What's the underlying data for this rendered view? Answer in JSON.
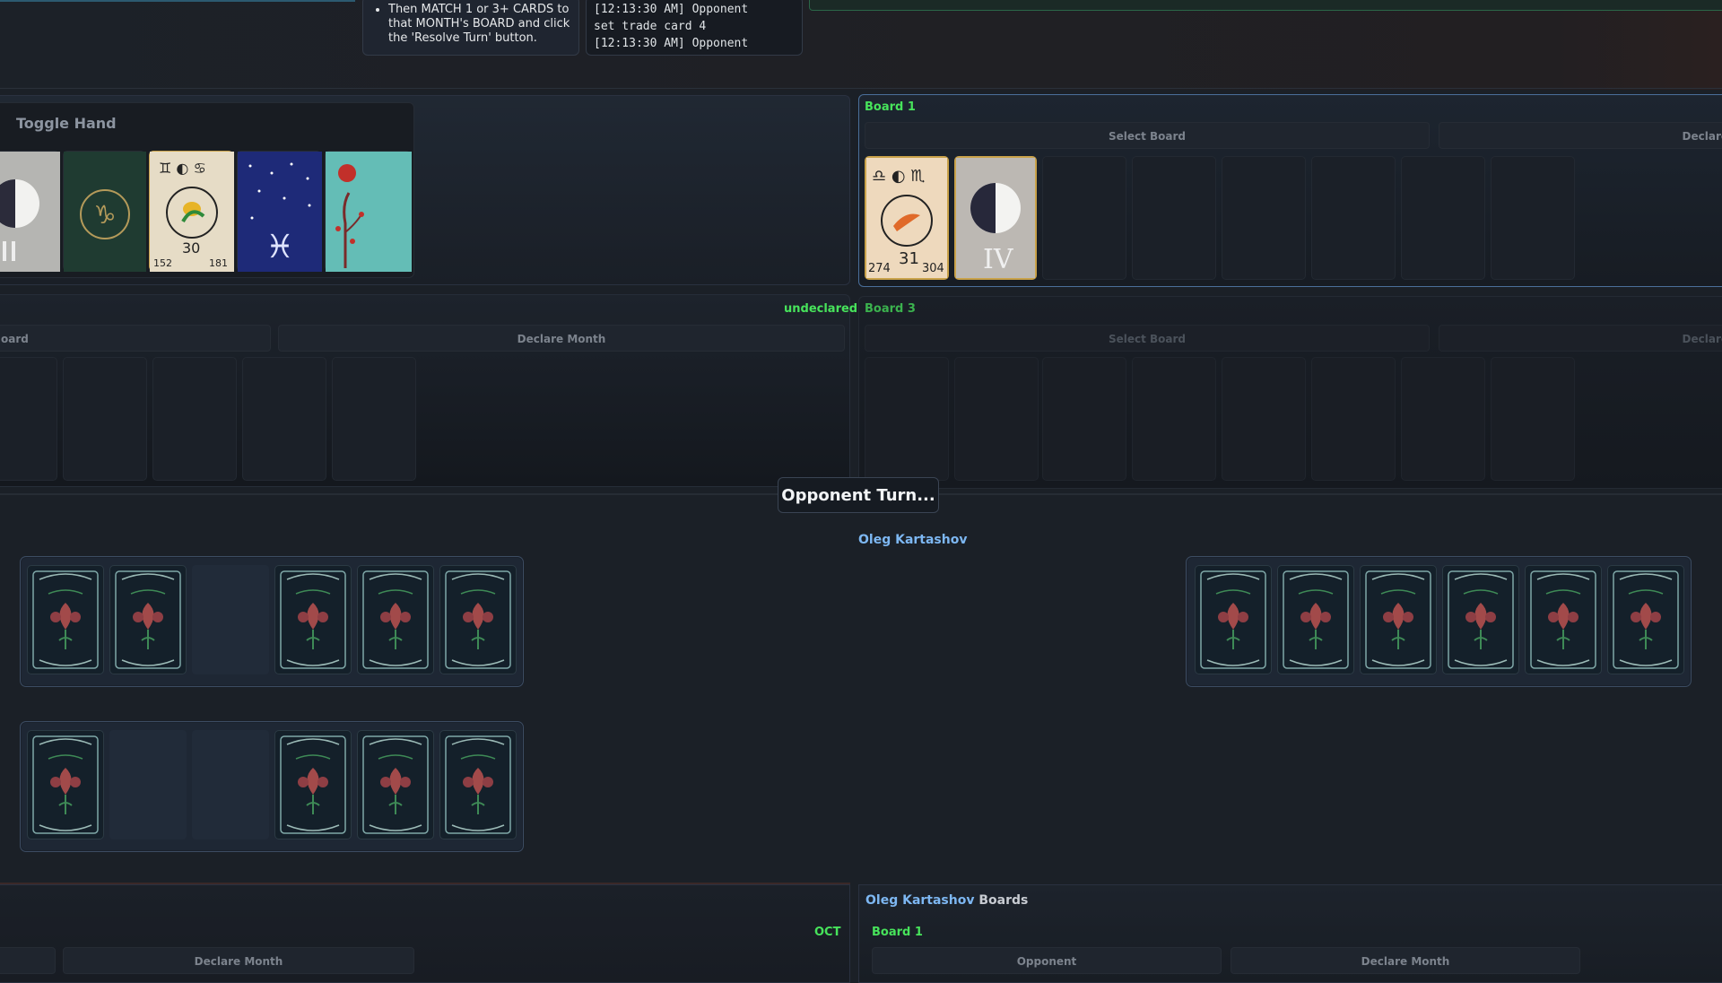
{
  "instructions": {
    "item": "Then MATCH 1 or 3+ CARDS to that MONTH's BOARD and click the 'Resolve Turn' button."
  },
  "log": {
    "lines": [
      "[12:13:30 AM] Opponent",
      "set trade card 4",
      "[12:13:30 AM] Opponent"
    ]
  },
  "hand": {
    "toggle_label": "Toggle Hand",
    "card_numbers": [
      "30",
      "152",
      "181"
    ]
  },
  "left_mid": {
    "status": "undeclared",
    "select_label": "oard",
    "declare_label": "Declare Month"
  },
  "board1": {
    "title": "Board 1",
    "select_label": "Select Board",
    "declare_label": "Declare",
    "card_numbers": [
      "31",
      "274",
      "304"
    ],
    "card_numeral": "IV"
  },
  "board3": {
    "title": "Board 3",
    "select_label": "Select Board",
    "declare_label": "Declare"
  },
  "turn_indicator": "Opponent Turn...",
  "opponent": {
    "name": "Oleg Kartashov"
  },
  "bottom_left": {
    "month": "OCT",
    "declare_label": "Declare Month"
  },
  "bottom_right": {
    "owner": "Oleg Kartashov",
    "suffix": "Boards",
    "board_title": "Board 1",
    "select_label": "Opponent",
    "declare_label": "Declare Month"
  },
  "colors": {
    "accent_green": "#47e35b",
    "player_blue": "#7db7f2",
    "card_gold": "#c9a24a"
  }
}
